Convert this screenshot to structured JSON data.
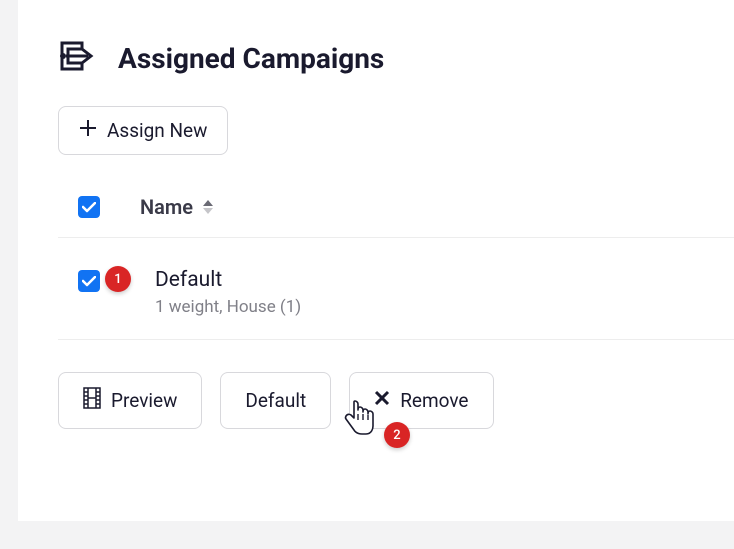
{
  "header": {
    "title": "Assigned Campaigns"
  },
  "buttons": {
    "assign_new": "Assign New",
    "preview": "Preview",
    "default": "Default",
    "remove": "Remove"
  },
  "table": {
    "col_name": "Name"
  },
  "rows": [
    {
      "title": "Default",
      "subtitle": "1 weight,  House (1)"
    }
  ],
  "callouts": {
    "one": "1",
    "two": "2"
  }
}
